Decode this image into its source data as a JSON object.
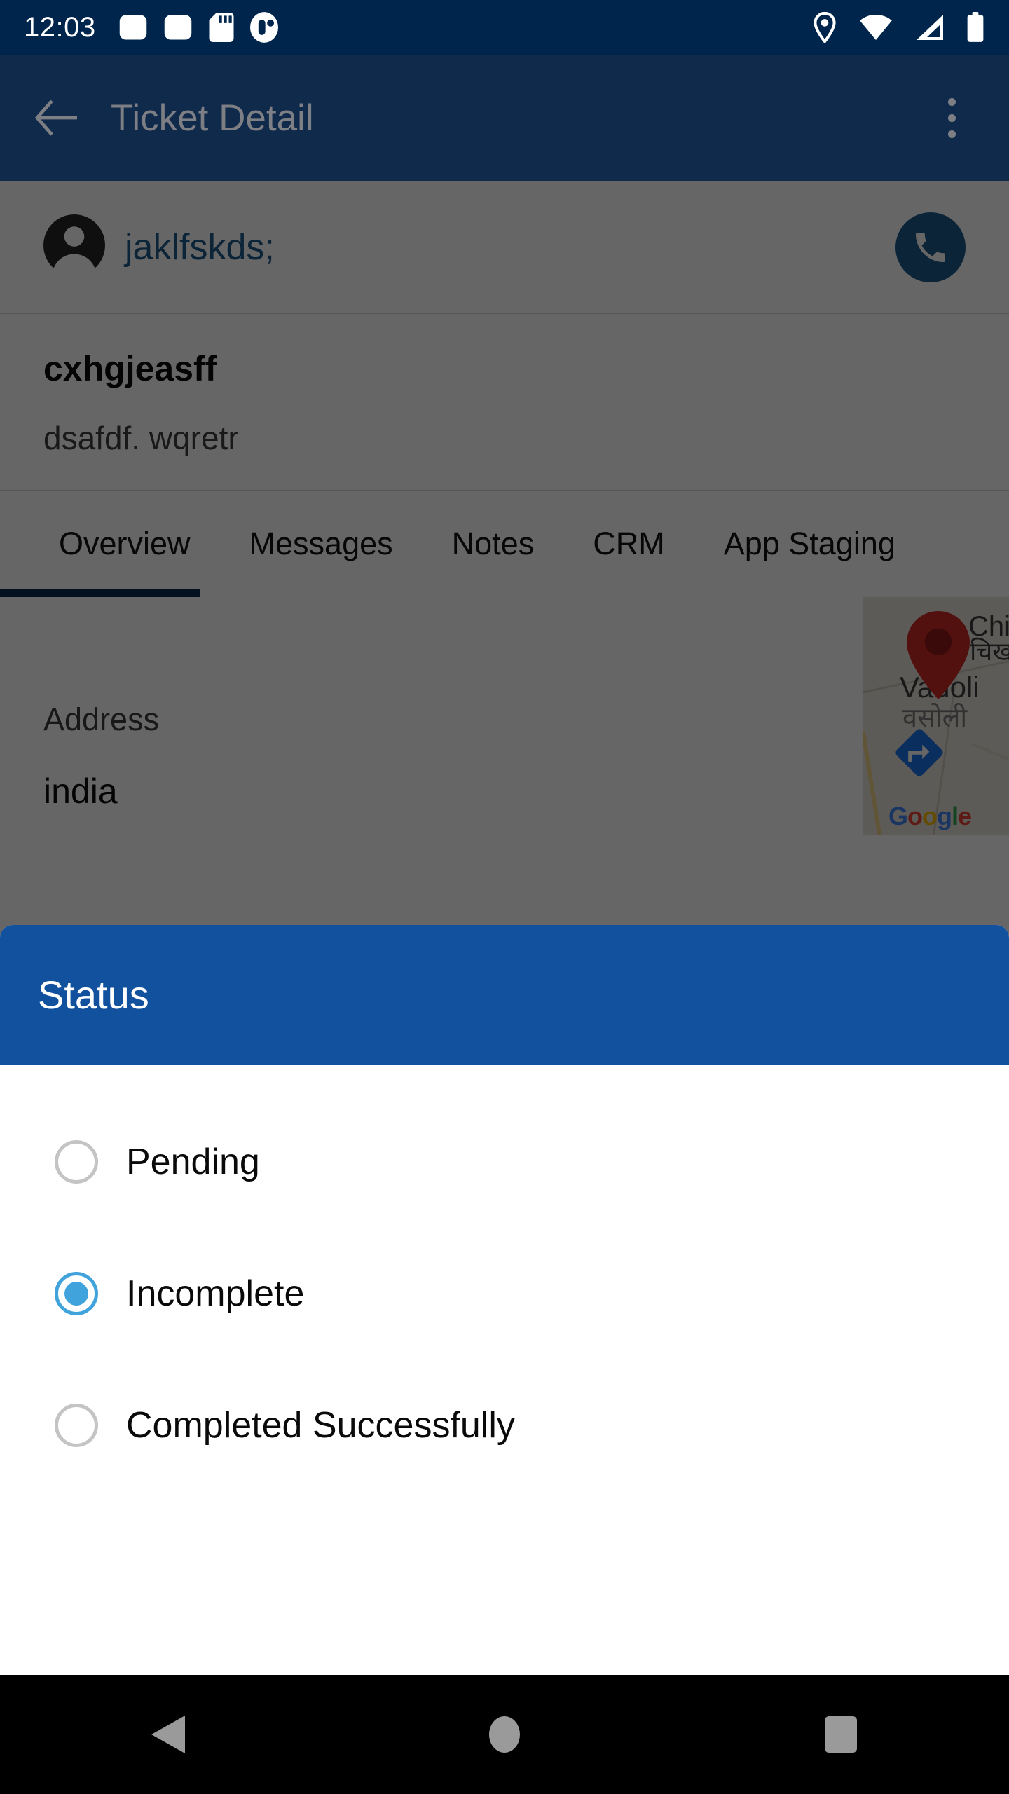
{
  "status_bar": {
    "clock": "12:03",
    "left_icons": [
      "data-saver-icon",
      "data-saver-icon",
      "sd-card-icon",
      "app-badge-icon"
    ],
    "right_icons": [
      "location-icon",
      "wifi-icon",
      "cellular-signal-icon",
      "battery-icon"
    ],
    "background_color": "#00254C"
  },
  "app_bar": {
    "title": "Ticket Detail",
    "back_icon": "arrow-left-icon",
    "overflow_icon": "more-vertical-icon",
    "background_color": "#0F2A4A"
  },
  "contact": {
    "avatar_icon": "person-icon",
    "name": "jaklfskds;",
    "call_icon": "phone-icon",
    "call_button_color": "#1C5A8C",
    "name_color": "#1C5A8C"
  },
  "ticket": {
    "title": "cxhgjeasff",
    "subtitle": "dsafdf. wqretr"
  },
  "tabs": {
    "active_index": 0,
    "indicator_color": "#0B2A4F",
    "items": [
      {
        "label": "Overview"
      },
      {
        "label": "Messages"
      },
      {
        "label": "Notes"
      },
      {
        "label": "CRM"
      },
      {
        "label": "App Staging"
      }
    ]
  },
  "address": {
    "label": "Address",
    "value": "india",
    "map": {
      "pin_icon": "map-pin-icon",
      "directions_icon": "directions-arrow-icon",
      "labels": [
        "Chik",
        "चिख",
        "Vadoli",
        "वसोली"
      ],
      "watermark": "Google",
      "pin_color": "#CC2B27",
      "directions_color": "#1A73E8"
    }
  },
  "status_dialog": {
    "title": "Status",
    "header_color": "#11519D",
    "accent_color": "#41A3DC",
    "options": [
      {
        "label": "Pending",
        "selected": false
      },
      {
        "label": "Incomplete",
        "selected": true
      },
      {
        "label": "Completed Successfully",
        "selected": false
      }
    ]
  },
  "nav_bar": {
    "back_icon": "nav-back-triangle-icon",
    "home_icon": "nav-home-circle-icon",
    "recents_icon": "nav-recents-square-icon",
    "icon_color": "#9A9A9A"
  }
}
